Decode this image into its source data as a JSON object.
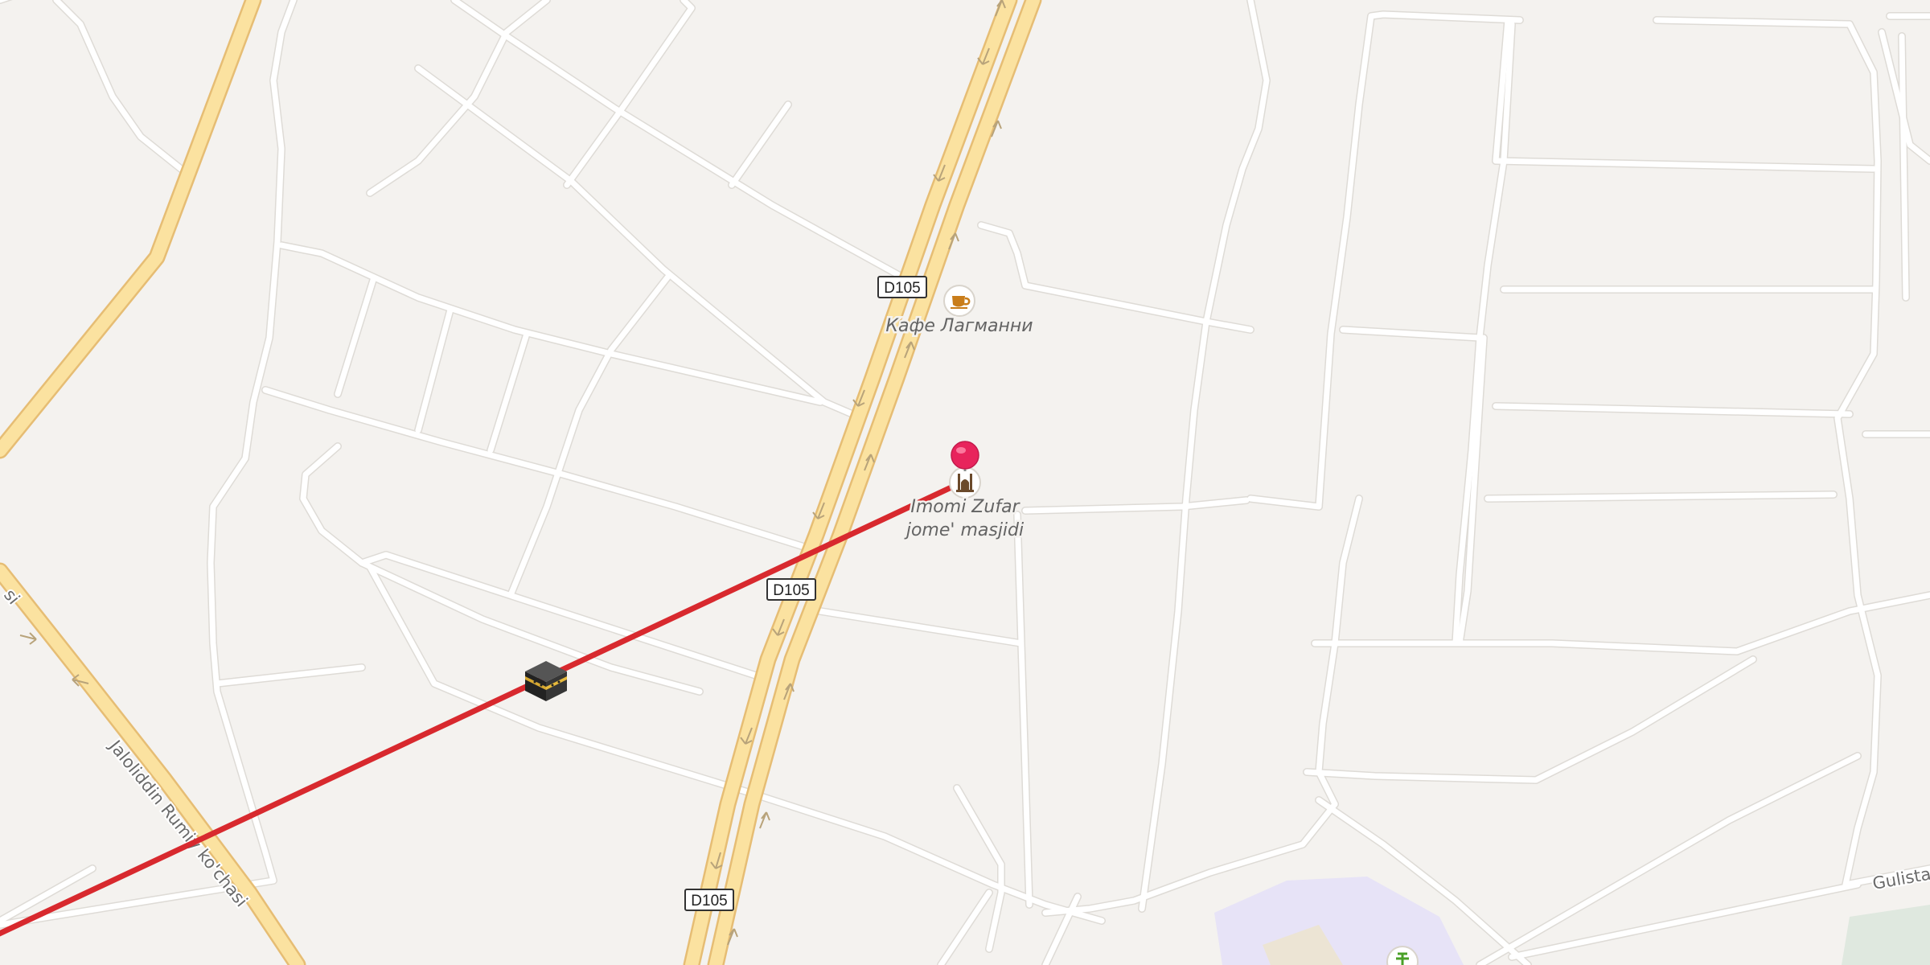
{
  "map": {
    "colors": {
      "background": "#f4f2ef",
      "street": "#ffffff",
      "primary_road": "#fbe2a0",
      "route_line": "#d8292e",
      "pin": "#e8245c",
      "park": "#e7e3f7"
    },
    "road_shields": [
      "D105",
      "D105",
      "D105"
    ],
    "pois": {
      "cafe": {
        "label": "Кафе Лагманни",
        "icon": "cafe-cup-icon"
      },
      "mosque": {
        "label_line1": "Imomi Zufar",
        "label_line2": "jome' masjidi",
        "icon": "mosque-icon"
      },
      "kaaba": {
        "icon": "kaaba-icon"
      },
      "sports": {
        "icon": "sports-pitch-icon"
      }
    },
    "street_labels": {
      "rumiy": "Jaloliddin Rumiy ko'chasi",
      "rumiy_top_fragment": "si",
      "gulistan": "Gulistan"
    },
    "selected_pin": {
      "icon": "location-pin-icon"
    }
  }
}
